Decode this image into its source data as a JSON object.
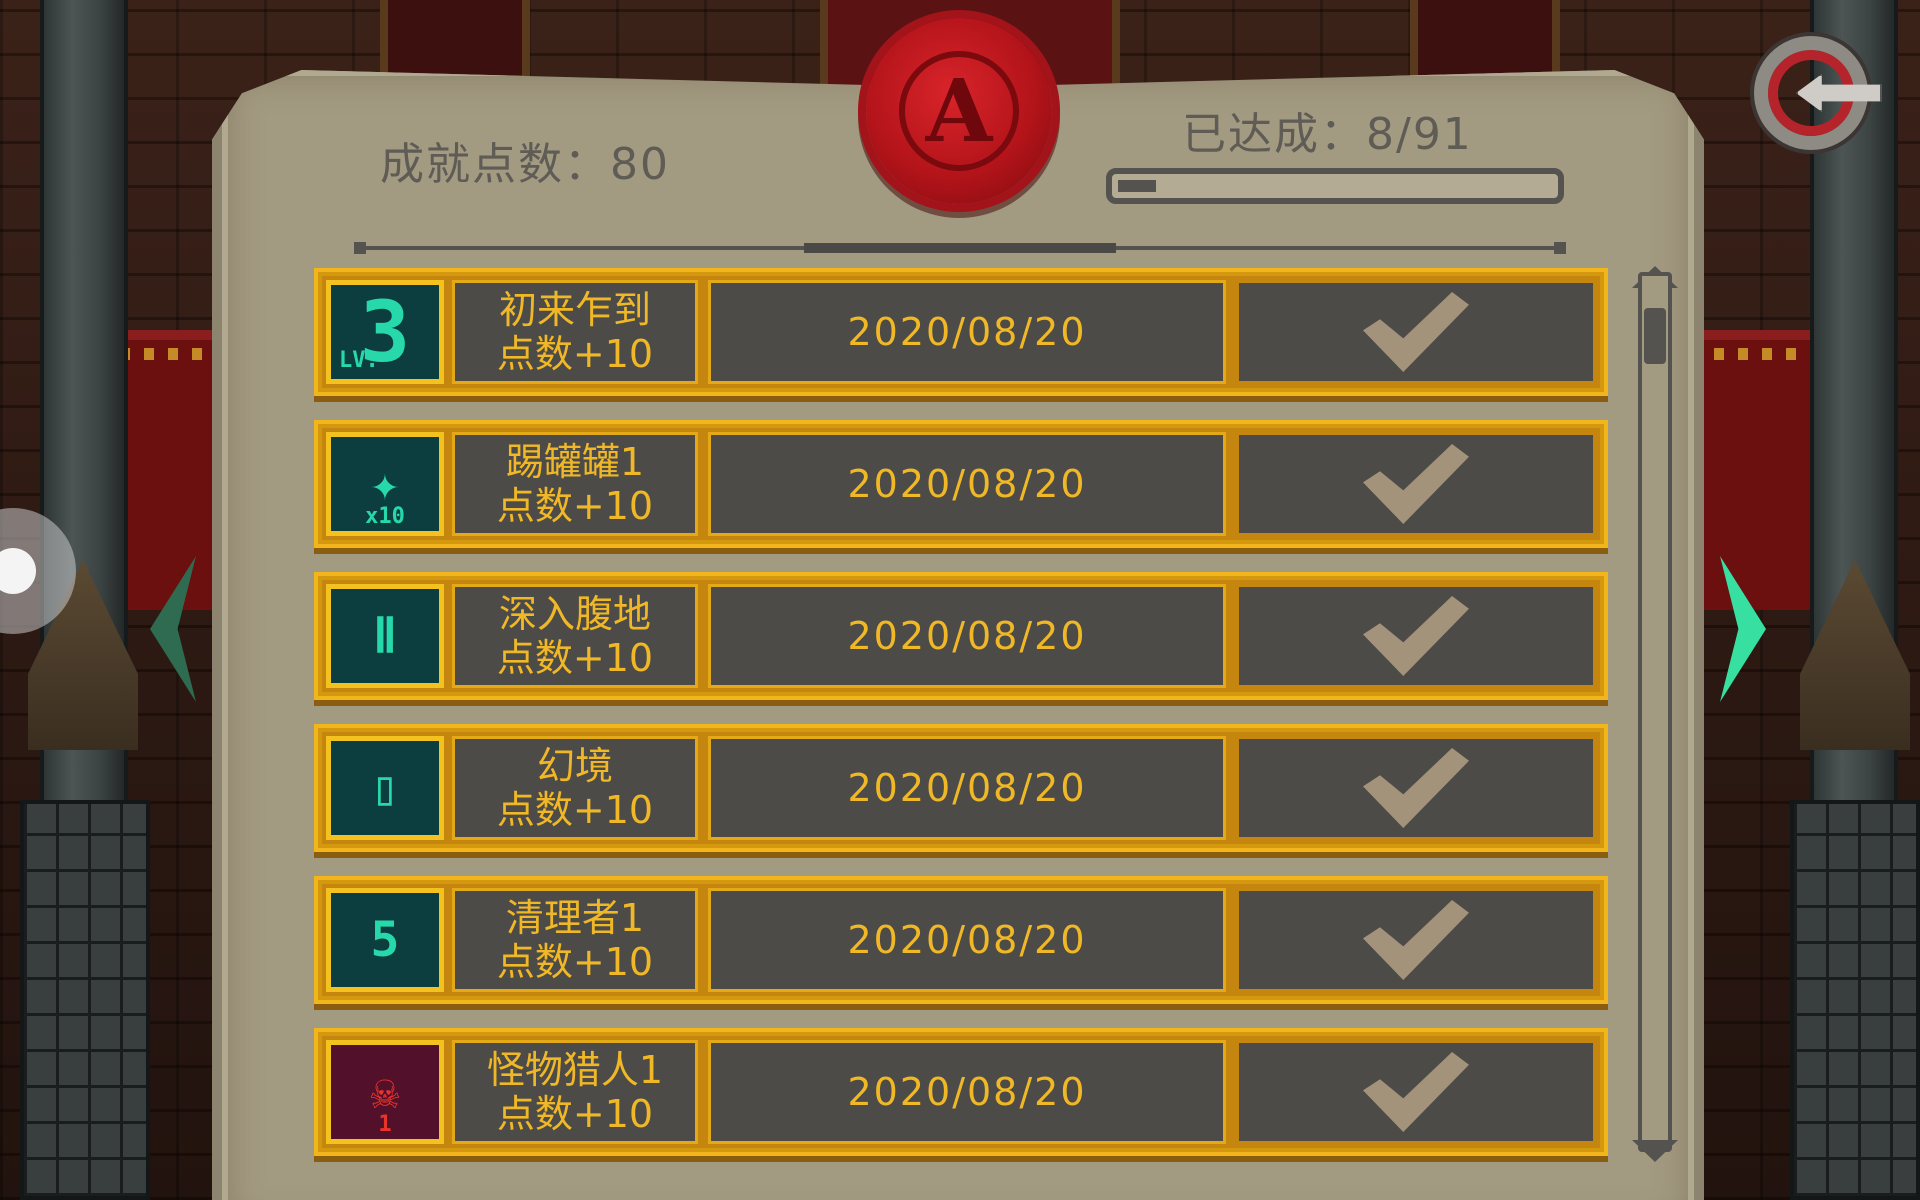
{
  "header": {
    "points_label": "成就点数：80",
    "completed_label": "已达成：8/91",
    "completed": 8,
    "total": 91,
    "seal_letter": "A"
  },
  "achievements": [
    {
      "icon": "level-3-icon",
      "icon_text": "3",
      "icon_sub": "LV.",
      "name": "初来乍到",
      "reward": "点数+10",
      "date": "2020/08/20",
      "done": true
    },
    {
      "icon": "jar-break-icon",
      "icon_text": "✦",
      "icon_sub": "x10",
      "name": "踢罐罐1",
      "reward": "点数+10",
      "date": "2020/08/20",
      "done": true
    },
    {
      "icon": "shrine-icon",
      "icon_text": "Ⅱ",
      "icon_sub": "",
      "name": "深入腹地",
      "reward": "点数+10",
      "date": "2020/08/20",
      "done": true
    },
    {
      "icon": "door-icon",
      "icon_text": "▯",
      "icon_sub": "",
      "name": "幻境",
      "reward": "点数+10",
      "date": "2020/08/20",
      "done": true
    },
    {
      "icon": "target-5-icon",
      "icon_text": "5",
      "icon_sub": "",
      "name": "清理者1",
      "reward": "点数+10",
      "date": "2020/08/20",
      "done": true
    },
    {
      "icon": "monster-skull-icon",
      "icon_text": "☠",
      "icon_sub": "1",
      "name": "怪物猎人1",
      "reward": "点数+10",
      "date": "2020/08/20",
      "done": true
    }
  ],
  "colors": {
    "gold": "#f0b826",
    "panel": "#4c4b48",
    "parchment": "#a39a82",
    "teal_icon": "#27d9aa",
    "red_icon": "#e8342a"
  }
}
